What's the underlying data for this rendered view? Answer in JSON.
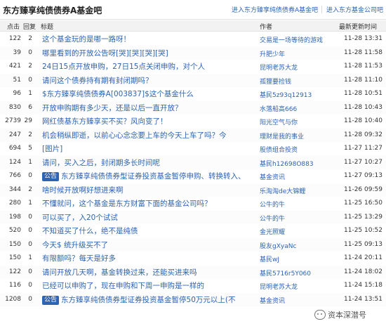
{
  "forum": {
    "title": "东方臻享纯债债券A基金吧",
    "links": [
      "进入东方臻享纯债债券A基金吧",
      "进入东方基金公司吧"
    ]
  },
  "columns": {
    "clicks": "点击",
    "replies": "回复",
    "title": "标题",
    "author": "作者",
    "time": "最新更新时间"
  },
  "posts": [
    {
      "clicks": "122",
      "replies": "2",
      "title": "这个基金玩的是哪一路呀！",
      "author": "交易是一场等待的游戏",
      "time": "11-28 13:31",
      "badge": ""
    },
    {
      "clicks": "39",
      "replies": "0",
      "title": "哪里看到的开放公告呀[哭][哭][哭][哭]",
      "author": "升肥少年",
      "time": "11-28 11:58",
      "badge": ""
    },
    {
      "clicks": "421",
      "replies": "2",
      "title": "24日15点开放申购，27日15点关闭申购，对个人",
      "author": "昆明老苏大龙",
      "time": "11-28 11:53",
      "badge": ""
    },
    {
      "clicks": "51",
      "replies": "0",
      "title": "请问这个债券持有期有封闭期吗？",
      "author": "孤狸要捡钱",
      "time": "11-28 11:10",
      "badge": ""
    },
    {
      "clicks": "96",
      "replies": "1",
      "title": "$东方臻享纯债债券A[003837]$这个基金什么",
      "author": "基民5z93q12913",
      "time": "11-28 10:51",
      "badge": ""
    },
    {
      "clicks": "830",
      "replies": "6",
      "title": "开放申购期有多少天，还是以后一直开放？",
      "author": "水落船高666",
      "time": "11-28 10:43",
      "badge": ""
    },
    {
      "clicks": "2739",
      "replies": "29",
      "title": "网红债基东方臻享买不买？风向变了！",
      "author": "阳光空气与你",
      "time": "11-28 10:40",
      "badge": ""
    },
    {
      "clicks": "247",
      "replies": "2",
      "title": "机会稍纵即逝，以前心心念念要上车的今天上车了吗？今",
      "author": "理财是我的事业",
      "time": "11-28 09:32",
      "badge": ""
    },
    {
      "clicks": "694",
      "replies": "5",
      "title": "[图片]",
      "author": "股债组合投资",
      "time": "11-27 11:27",
      "badge": ""
    },
    {
      "clicks": "124",
      "replies": "1",
      "title": "请问，买入之后，封闭期多长时间呢",
      "author": "基民h12698O883",
      "time": "11-27 10:27",
      "badge": ""
    },
    {
      "clicks": "766",
      "replies": "0",
      "title": "东方臻享纯债债券型证券投资基金暂停申购、转换转入、",
      "author": "基金资讯",
      "time": "11-27 09:13",
      "badge": "公告"
    },
    {
      "clicks": "344",
      "replies": "2",
      "title": "啥时候开放啊好想进来啊",
      "author": "乐淘淘de大锦鲤",
      "time": "11-26 09:59",
      "badge": ""
    },
    {
      "clicks": "280",
      "replies": "1",
      "title": "不懂就问，这个基金是东方财富下面的基金公司吗？",
      "author": "公牛的牛",
      "time": "11-25 16:50",
      "badge": ""
    },
    {
      "clicks": "198",
      "replies": "0",
      "title": "可以买了，入20个试试",
      "author": "公牛的牛",
      "time": "11-25 13:29",
      "badge": ""
    },
    {
      "clicks": "520",
      "replies": "0",
      "title": "不知道买了什么，绝不是纯债",
      "author": "金光照耀",
      "time": "11-25 10:52",
      "badge": ""
    },
    {
      "clicks": "150",
      "replies": "0",
      "title": "今天$  统升级买不了",
      "author": "股友gXyaNc",
      "time": "11-25 09:13",
      "badge": ""
    },
    {
      "clicks": "150",
      "replies": "1",
      "title": "有限额吗？每天是好多",
      "author": "基民wJ",
      "time": "11-24 20:11",
      "badge": ""
    },
    {
      "clicks": "122",
      "replies": "0",
      "title": "请问开放几天啊，基金转换过来，还能买进来吗",
      "author": "基民5716r5Y060",
      "time": "11-24 18:02",
      "badge": ""
    },
    {
      "clicks": "116",
      "replies": "0",
      "title": "已经可以申购了，现在申购和下周一申购是一样的",
      "author": "昆明老苏大龙",
      "time": "11-24 15:18",
      "badge": ""
    },
    {
      "clicks": "1208",
      "replies": "0",
      "title": "东方臻享纯债债券型证券投资基金暂停50万元以上(不",
      "author": "基金资讯",
      "time": "11-24 13:51",
      "badge": "公告"
    }
  ],
  "watermark": "资本深潜号"
}
